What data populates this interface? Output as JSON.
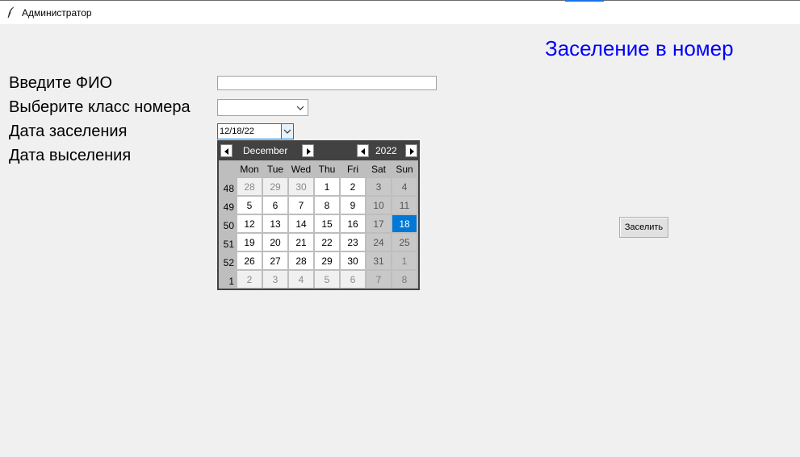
{
  "window": {
    "title": "Администратор"
  },
  "heading": "Заселение в номер",
  "labels": {
    "fio": "Введите ФИО",
    "room_class": "Выберите класс номера",
    "checkin": "Дата заселения",
    "checkout": "Дата выселения"
  },
  "fields": {
    "fio_value": "",
    "room_class_value": "",
    "checkin_value": "12/18/22"
  },
  "calendar": {
    "month": "December",
    "year": "2022",
    "weekdays": [
      "Mon",
      "Tue",
      "Wed",
      "Thu",
      "Fri",
      "Sat",
      "Sun"
    ],
    "weeks": [
      {
        "num": "48",
        "days": [
          "28",
          "29",
          "30",
          "1",
          "2",
          "3",
          "4"
        ]
      },
      {
        "num": "49",
        "days": [
          "5",
          "6",
          "7",
          "8",
          "9",
          "10",
          "11"
        ]
      },
      {
        "num": "50",
        "days": [
          "12",
          "13",
          "14",
          "15",
          "16",
          "17",
          "18"
        ]
      },
      {
        "num": "51",
        "days": [
          "19",
          "20",
          "21",
          "22",
          "23",
          "24",
          "25"
        ]
      },
      {
        "num": "52",
        "days": [
          "26",
          "27",
          "28",
          "29",
          "30",
          "31",
          "1"
        ]
      },
      {
        "num": "1",
        "days": [
          "2",
          "3",
          "4",
          "5",
          "6",
          "7",
          "8"
        ]
      }
    ],
    "selected_day": "18"
  },
  "submit_label": "Заселить",
  "colors": {
    "heading": "#0000ff",
    "selection": "#0078d7",
    "calendar_header": "#424242"
  },
  "icons": {
    "app": "feather-icon",
    "dropdown": "chevron-down-icon",
    "prev": "triangle-left-icon",
    "next": "triangle-right-icon"
  }
}
